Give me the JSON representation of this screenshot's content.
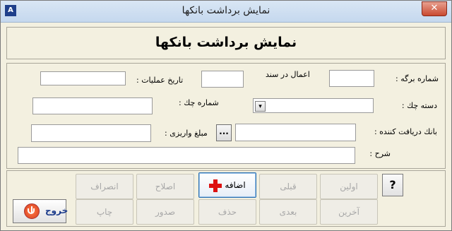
{
  "window": {
    "title": "نمایش برداشت بانکها",
    "close_glyph": "✕",
    "icon_glyph": "A"
  },
  "header": {
    "title": "نمایش برداشت بانکها"
  },
  "form": {
    "sheet_number_label": "شماره برگه :",
    "operations_in_doc_label": "اعمال در سند",
    "operation_date_label": "تاریخ عملیات :",
    "check_book_label": "دسته چك :",
    "check_number_label": "شماره چك :",
    "receiver_bank_label": "بانك دریافت كننده :",
    "deposit_amount_label": "مبلغ واریزی :",
    "description_label": "شرح :",
    "sheet_number_value": "",
    "operations_in_doc_value": "",
    "operation_date_value": "",
    "check_book_value": "",
    "check_number_value": "",
    "receiver_bank_value": "",
    "deposit_amount_value": "",
    "description_value": "",
    "browse_button": "..."
  },
  "buttons": {
    "first": "اولین",
    "previous": "قبلی",
    "add": "اضافه",
    "edit": "اصلاح",
    "cancel": "انصراف",
    "last": "آخرین",
    "next": "بعدی",
    "delete": "حذف",
    "issue": "صدور",
    "print": "چاپ",
    "help": "?",
    "exit": "خروج"
  },
  "icons": {
    "add": "plus-icon",
    "exit": "power-icon",
    "combo": "chevron-down-icon"
  },
  "colors": {
    "add_plus": "#dd1111",
    "exit_icon": "#d8401c",
    "disabled_text": "#a8a8a8"
  }
}
